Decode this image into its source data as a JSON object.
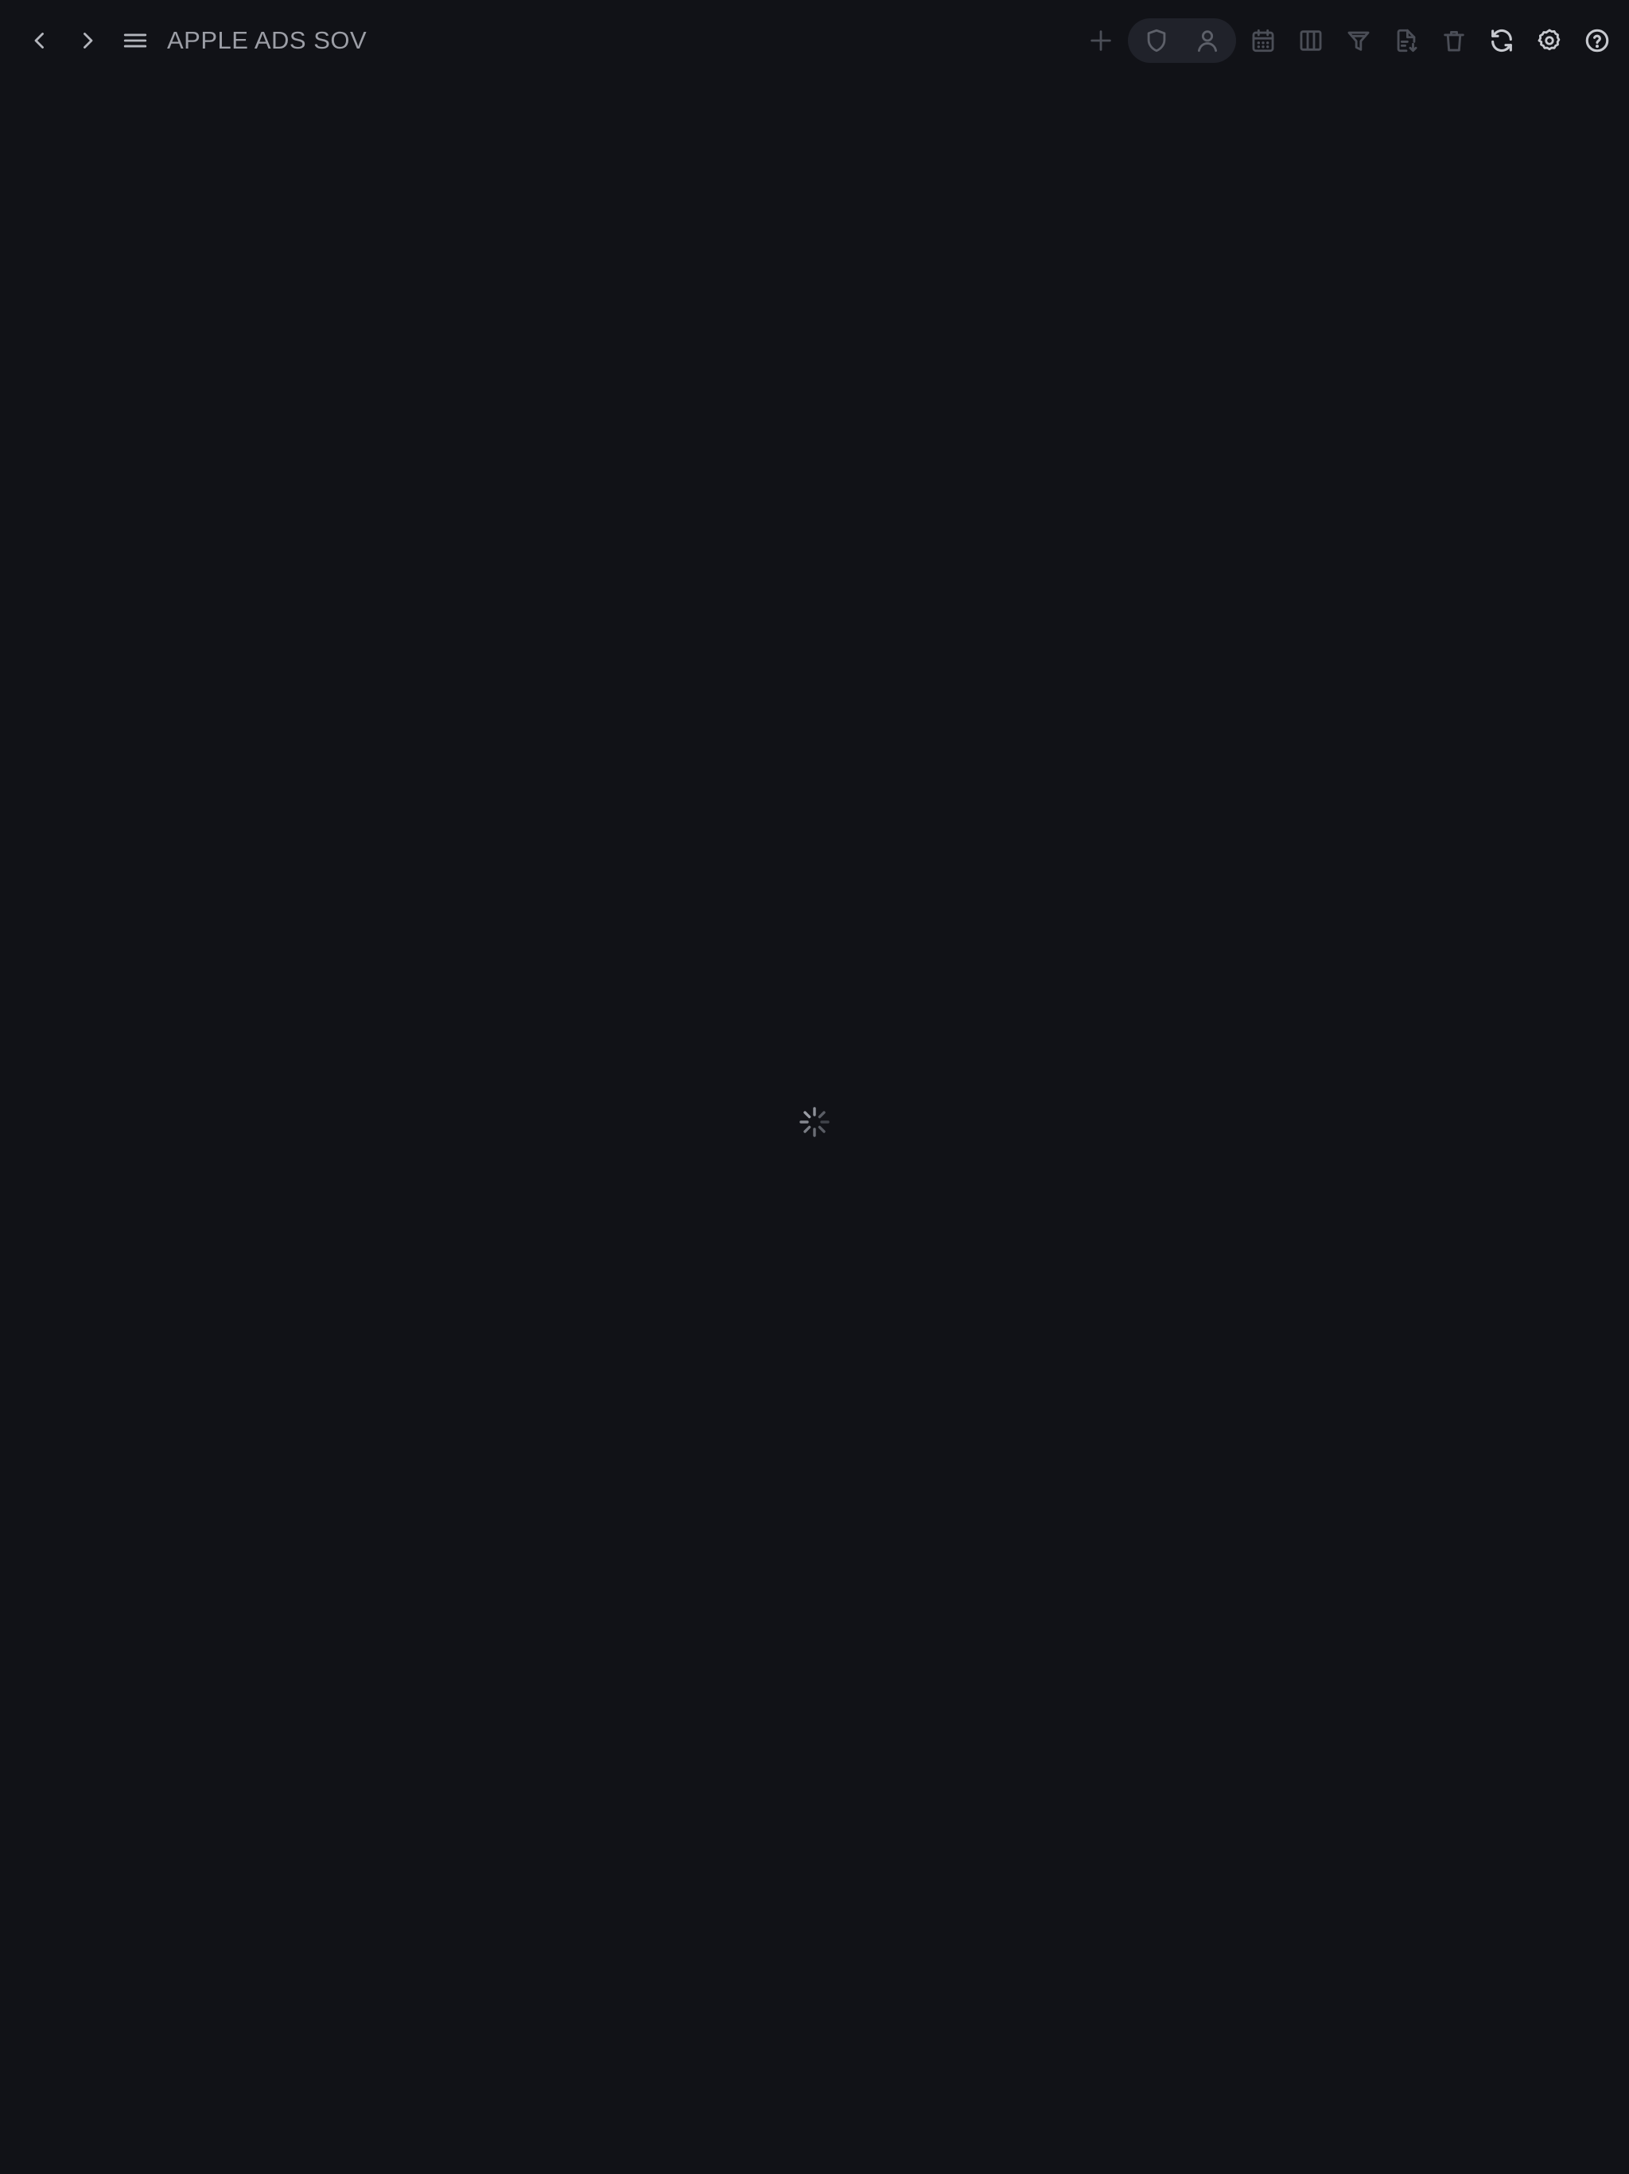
{
  "header": {
    "title": "APPLE ADS SOV"
  },
  "icons": {
    "back": "chevron-left-icon",
    "forward": "chevron-right-icon",
    "menu": "hamburger-menu-icon",
    "add": "plus-icon",
    "shield": "shield-icon",
    "user": "user-icon",
    "calendar": "calendar-icon",
    "columns": "columns-icon",
    "filter": "filter-icon",
    "export": "document-export-icon",
    "delete": "trash-icon",
    "refresh": "refresh-icon",
    "settings": "gear-icon",
    "help": "help-circle-icon",
    "loading": "loading-spinner-icon"
  },
  "colors": {
    "background": "#111217",
    "pill": "#20222a",
    "title": "#9c9ea6",
    "icon_active": "#c7c9cf",
    "icon_disabled": "#4b4e57"
  }
}
